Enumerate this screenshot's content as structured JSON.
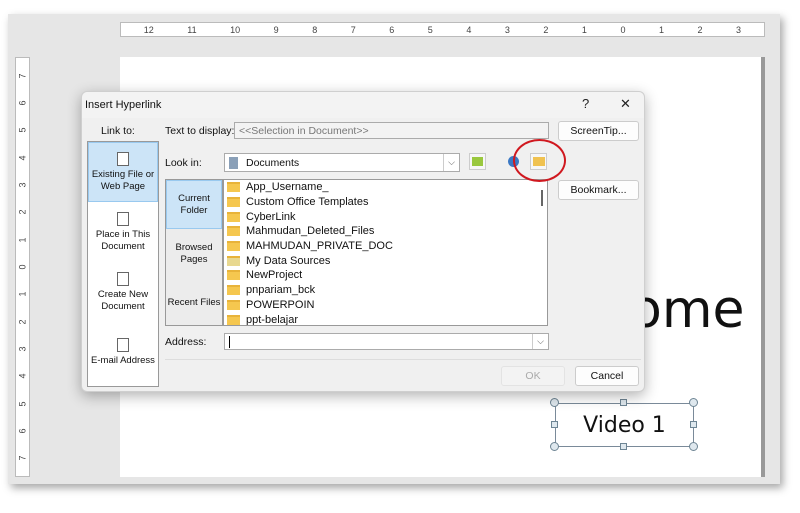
{
  "ruler": {
    "horizontal": [
      "12",
      "11",
      "10",
      "9",
      "8",
      "7",
      "6",
      "5",
      "4",
      "3",
      "2",
      "1",
      "0",
      "1",
      "2",
      "3"
    ],
    "vertical": [
      "7",
      "6",
      "5",
      "4",
      "3",
      "2",
      "1",
      "0",
      "1",
      "2",
      "3",
      "4",
      "5",
      "6",
      "7"
    ]
  },
  "slide": {
    "title_fragment": "ome",
    "textbox": "Video 1"
  },
  "dialog": {
    "title": "Insert Hyperlink",
    "help": "?",
    "close": "✕",
    "link_to_label": "Link to:",
    "link_to": [
      {
        "label": "Existing File or Web Page",
        "selected": true
      },
      {
        "label": "Place in This Document"
      },
      {
        "label": "Create New Document"
      },
      {
        "label": "E-mail Address"
      }
    ],
    "text_to_display_label": "Text to display:",
    "text_to_display_value": "<<Selection in Document>>",
    "screentip": "ScreenTip...",
    "look_in_label": "Look in:",
    "look_in_value": "Documents",
    "bookmark": "Bookmark...",
    "nav": [
      {
        "label": "Current Folder",
        "selected": true
      },
      {
        "label": "Browsed Pages"
      },
      {
        "label": "Recent Files"
      }
    ],
    "files": [
      {
        "name": "App_Username_",
        "icon": "folder"
      },
      {
        "name": "Custom Office Templates",
        "icon": "folder"
      },
      {
        "name": "CyberLink",
        "icon": "folder"
      },
      {
        "name": "Mahmudan_Deleted_Files",
        "icon": "folder"
      },
      {
        "name": "MAHMUDAN_PRIVATE_DOC",
        "icon": "folder"
      },
      {
        "name": "My Data Sources",
        "icon": "data-sources-folder"
      },
      {
        "name": "NewProject",
        "icon": "folder"
      },
      {
        "name": "pnpariam_bck",
        "icon": "folder"
      },
      {
        "name": "POWERPOIN",
        "icon": "folder"
      },
      {
        "name": "ppt-belajar",
        "icon": "folder"
      }
    ],
    "address_label": "Address:",
    "address_value": "",
    "ok": "OK",
    "cancel": "Cancel",
    "highlight_color": "#d0181f"
  }
}
